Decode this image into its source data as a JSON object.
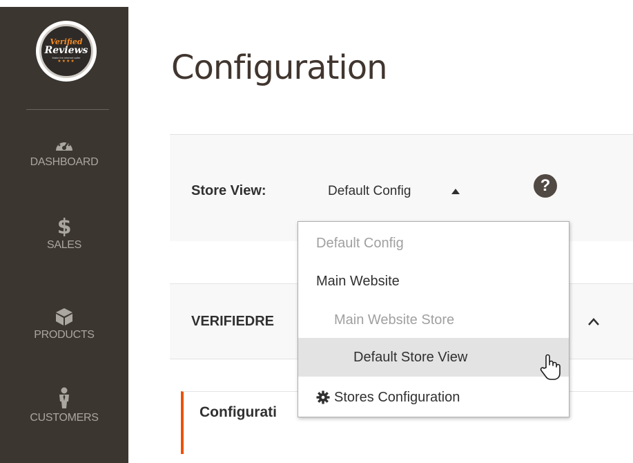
{
  "sidebar": {
    "logo": {
      "line1": "Verified",
      "line2": "Reviews",
      "line3": "Make the internet safer",
      "line4": "★★★★"
    },
    "items": [
      {
        "label": "DASHBOARD",
        "icon": "dashboard-gauge-icon"
      },
      {
        "label": "SALES",
        "icon": "dollar-icon"
      },
      {
        "label": "PRODUCTS",
        "icon": "box-icon"
      },
      {
        "label": "CUSTOMERS",
        "icon": "person-icon"
      }
    ]
  },
  "main": {
    "title": "Configuration",
    "store_view": {
      "label": "Store View:",
      "value": "Default Config"
    },
    "section": {
      "title": "VERIFIEDRE"
    },
    "subsection": {
      "title": "Configurati"
    }
  },
  "dropdown": {
    "items": [
      {
        "label": "Default Config",
        "state": "disabled"
      },
      {
        "label": "Main Website",
        "state": "normal"
      },
      {
        "label": "Main Website Store",
        "state": "disabled"
      },
      {
        "label": "Default Store View",
        "state": "selected"
      },
      {
        "label": "Stores Configuration",
        "state": "normal",
        "icon": "gear-icon"
      }
    ]
  },
  "colors": {
    "sidebar_bg": "#3c3630",
    "accent": "#eb5202",
    "text_dark": "#303030"
  }
}
